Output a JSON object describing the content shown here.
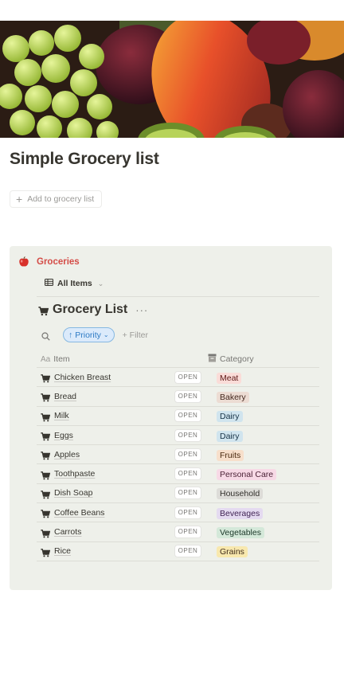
{
  "page": {
    "title": "Simple Grocery list",
    "add_button_label": "Add to grocery list"
  },
  "callout": {
    "label": "Groceries",
    "icon": "apple-icon"
  },
  "database": {
    "view_tab_label": "All Items",
    "title": "Grocery List",
    "more_label": "···",
    "sort_chip_label": "Priority",
    "filter_label": "+ Filter",
    "columns": {
      "name_label": "Item",
      "name_prefix": "Aa",
      "category_label": "Category"
    },
    "open_label": "OPEN",
    "rows": [
      {
        "item": "Chicken Breast",
        "category": "Meat",
        "tag_bg": "#fadcd8",
        "tag_fg": "#5d1715"
      },
      {
        "item": "Bread",
        "category": "Bakery",
        "tag_bg": "#ecdcd3",
        "tag_fg": "#44281e"
      },
      {
        "item": "Milk",
        "category": "Dairy",
        "tag_bg": "#d0e4ee",
        "tag_fg": "#183347"
      },
      {
        "item": "Eggs",
        "category": "Dairy",
        "tag_bg": "#d0e4ee",
        "tag_fg": "#183347"
      },
      {
        "item": "Apples",
        "category": "Fruits",
        "tag_bg": "#f7dfcb",
        "tag_fg": "#49290e"
      },
      {
        "item": "Toothpaste",
        "category": "Personal Care",
        "tag_bg": "#f7d9e6",
        "tag_fg": "#4c2337"
      },
      {
        "item": "Dish Soap",
        "category": "Household",
        "tag_bg": "#dddcd8",
        "tag_fg": "#32302c"
      },
      {
        "item": "Coffee Beans",
        "category": "Beverages",
        "tag_bg": "#e4daf0",
        "tag_fg": "#412454"
      },
      {
        "item": "Carrots",
        "category": "Vegetables",
        "tag_bg": "#d4e8d9",
        "tag_fg": "#1c3829"
      },
      {
        "item": "Rice",
        "category": "Grains",
        "tag_bg": "#f8e8ae",
        "tag_fg": "#402c1b"
      }
    ]
  }
}
